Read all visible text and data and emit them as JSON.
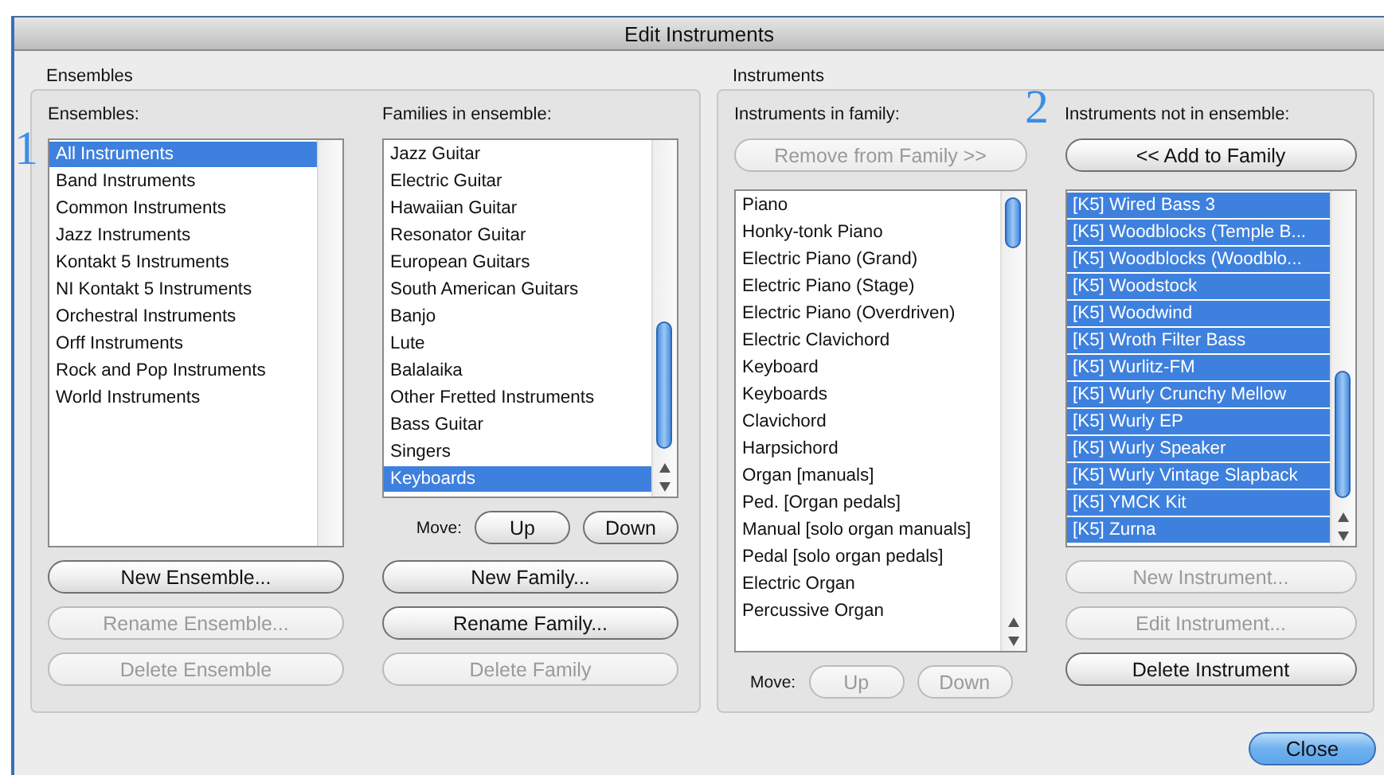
{
  "window": {
    "title": "Edit Instruments"
  },
  "groups": [
    {
      "title": "Ensembles",
      "columns": [
        {
          "label": "Ensembles:",
          "annotation": {
            "text": "1",
            "kind": "list-side"
          },
          "list": [
            {
              "text": "All Instruments",
              "selected": true
            },
            {
              "text": "Band Instruments",
              "selected": false
            },
            {
              "text": "Common Instruments",
              "selected": false
            },
            {
              "text": "Jazz Instruments",
              "selected": false
            },
            {
              "text": "Kontakt 5 Instruments",
              "selected": false
            },
            {
              "text": "NI Kontakt 5 Instruments",
              "selected": false
            },
            {
              "text": "Orchestral Instruments",
              "selected": false
            },
            {
              "text": "Orff Instruments",
              "selected": false
            },
            {
              "text": "Rock and Pop Instruments",
              "selected": false
            },
            {
              "text": "World Instruments",
              "selected": false
            }
          ],
          "buttons": [
            {
              "label": "New Ensemble...",
              "disabled": false
            },
            {
              "label": "Rename Ensemble...",
              "disabled": true
            },
            {
              "label": "Delete Ensemble",
              "disabled": true
            }
          ]
        },
        {
          "label": "Families in ensemble:",
          "list": [
            {
              "text": "Jazz Guitar",
              "selected": false
            },
            {
              "text": "Electric Guitar",
              "selected": false
            },
            {
              "text": "Hawaiian Guitar",
              "selected": false
            },
            {
              "text": "Resonator Guitar",
              "selected": false
            },
            {
              "text": "European Guitars",
              "selected": false
            },
            {
              "text": "South American Guitars",
              "selected": false
            },
            {
              "text": "Banjo",
              "selected": false
            },
            {
              "text": "Lute",
              "selected": false
            },
            {
              "text": "Balalaika",
              "selected": false
            },
            {
              "text": "Other Fretted Instruments",
              "selected": false
            },
            {
              "text": "Bass Guitar",
              "selected": false
            },
            {
              "text": "Singers",
              "selected": false
            },
            {
              "text": "Keyboards",
              "selected": true
            }
          ],
          "move": {
            "label": "Move:",
            "buttons": [
              {
                "label": "Up",
                "disabled": false
              },
              {
                "label": "Down",
                "disabled": false
              }
            ]
          },
          "buttons": [
            {
              "label": "New Family...",
              "disabled": false
            },
            {
              "label": "Rename Family...",
              "disabled": false
            },
            {
              "label": "Delete Family",
              "disabled": true
            }
          ]
        }
      ]
    },
    {
      "title": "Instruments",
      "columns": [
        {
          "label": "Instruments in family:",
          "top_button": {
            "label": "Remove from Family >>",
            "disabled": true
          },
          "list": [
            {
              "text": "Piano",
              "selected": false
            },
            {
              "text": "Honky-tonk Piano",
              "selected": false
            },
            {
              "text": "Electric Piano (Grand)",
              "selected": false
            },
            {
              "text": "Electric Piano (Stage)",
              "selected": false
            },
            {
              "text": "Electric Piano (Overdriven)",
              "selected": false
            },
            {
              "text": "Electric Clavichord",
              "selected": false
            },
            {
              "text": "Keyboard",
              "selected": false
            },
            {
              "text": "Keyboards",
              "selected": false
            },
            {
              "text": "Clavichord",
              "selected": false
            },
            {
              "text": "Harpsichord",
              "selected": false
            },
            {
              "text": "Organ [manuals]",
              "selected": false
            },
            {
              "text": "Ped. [Organ pedals]",
              "selected": false
            },
            {
              "text": "Manual [solo organ manuals]",
              "selected": false
            },
            {
              "text": "Pedal [solo organ pedals]",
              "selected": false
            },
            {
              "text": "Electric Organ",
              "selected": false
            },
            {
              "text": "Percussive Organ",
              "selected": false
            }
          ],
          "move": {
            "label": "Move:",
            "buttons": [
              {
                "label": "Up",
                "disabled": true
              },
              {
                "label": "Down",
                "disabled": true
              }
            ]
          }
        },
        {
          "label": "Instruments not in ensemble:",
          "annotation": {
            "text": "2",
            "kind": "label-side"
          },
          "top_button": {
            "label": "<< Add to Family",
            "disabled": false
          },
          "list": [
            {
              "text": "[K5] Wired Bass 3",
              "selected": true
            },
            {
              "text": "[K5] Woodblocks (Temple B...",
              "selected": true
            },
            {
              "text": "[K5] Woodblocks (Woodblo...",
              "selected": true
            },
            {
              "text": "[K5] Woodstock",
              "selected": true
            },
            {
              "text": "[K5] Woodwind",
              "selected": true
            },
            {
              "text": "[K5] Wroth Filter Bass",
              "selected": true
            },
            {
              "text": "[K5] Wurlitz-FM",
              "selected": true
            },
            {
              "text": "[K5] Wurly Crunchy Mellow",
              "selected": true
            },
            {
              "text": "[K5] Wurly EP",
              "selected": true
            },
            {
              "text": "[K5] Wurly Speaker",
              "selected": true
            },
            {
              "text": "[K5] Wurly Vintage Slapback",
              "selected": true
            },
            {
              "text": "[K5] YMCK Kit",
              "selected": true
            },
            {
              "text": "[K5] Zurna",
              "selected": true
            }
          ],
          "buttons": [
            {
              "label": "New Instrument...",
              "disabled": true
            },
            {
              "label": "Edit Instrument...",
              "disabled": true
            },
            {
              "label": "Delete Instrument",
              "disabled": false
            }
          ]
        }
      ]
    }
  ],
  "footer": {
    "buttons": [
      {
        "label": "Close",
        "default": true
      }
    ]
  }
}
